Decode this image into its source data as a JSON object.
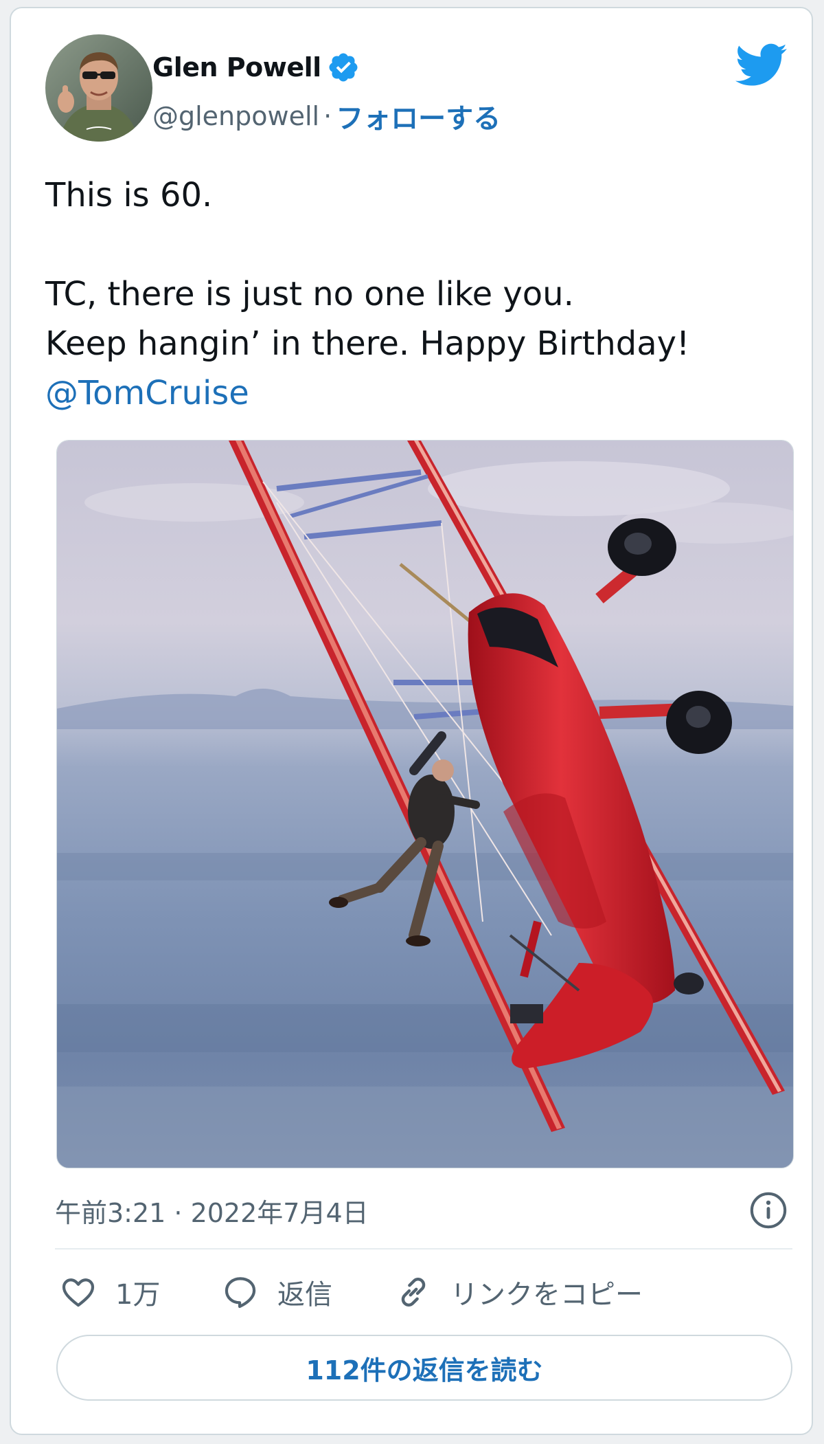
{
  "author": {
    "name": "Glen Powell",
    "handle": "@glenpowell",
    "separator": "·",
    "follow_label": "フォローする",
    "verified": true
  },
  "tweet": {
    "line1": "This is 60.",
    "line2": "TC, there is just no one like you.",
    "line3": "Keep hangin’ in there. Happy Birthday!",
    "mention": "@TomCruise"
  },
  "meta": {
    "timestamp": "午前3:21 · 2022年7月4日"
  },
  "actions": {
    "like_count": "1万",
    "reply_label": "返信",
    "copy_link_label": "リンクをコピー"
  },
  "read_replies_label": "112件の返信を読む",
  "colors": {
    "accent": "#1d70b8",
    "twitter_blue": "#1d9bf0",
    "verified": "#1d9bf0",
    "secondary_text": "#536471",
    "plane_red": "#d8202b"
  },
  "icons": {
    "logo": "twitter-bird-icon",
    "verified": "verified-badge-icon",
    "info": "info-icon",
    "like": "heart-icon",
    "reply": "speech-bubble-icon",
    "copy_link": "link-icon"
  }
}
